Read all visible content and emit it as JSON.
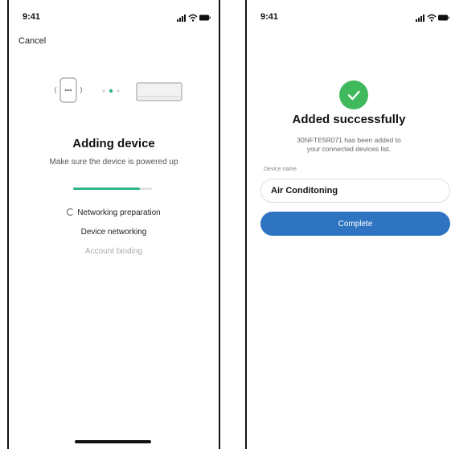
{
  "left_screen": {
    "status_time": "9:41",
    "cancel_label": "Cancel",
    "title": "Adding device",
    "subtitle": "Make sure the device is powered up",
    "progress": 0.85,
    "steps": [
      {
        "label": "Networking preparation",
        "state": "in-progress"
      },
      {
        "label": "Device networking",
        "state": "pending"
      },
      {
        "label": "Account binding",
        "state": "inactive"
      }
    ]
  },
  "right_screen": {
    "status_time": "9:41",
    "title": "Added successfully",
    "message": "30NFTE5R071 has been added to your connected devices list.",
    "device_name_label": "Device name",
    "device_name_value": "Air Conditoning",
    "complete_label": "Complete"
  },
  "colors": {
    "accent_green": "#2fb58b",
    "success_green": "#3fb95b",
    "button_blue": "#2f74c0"
  }
}
